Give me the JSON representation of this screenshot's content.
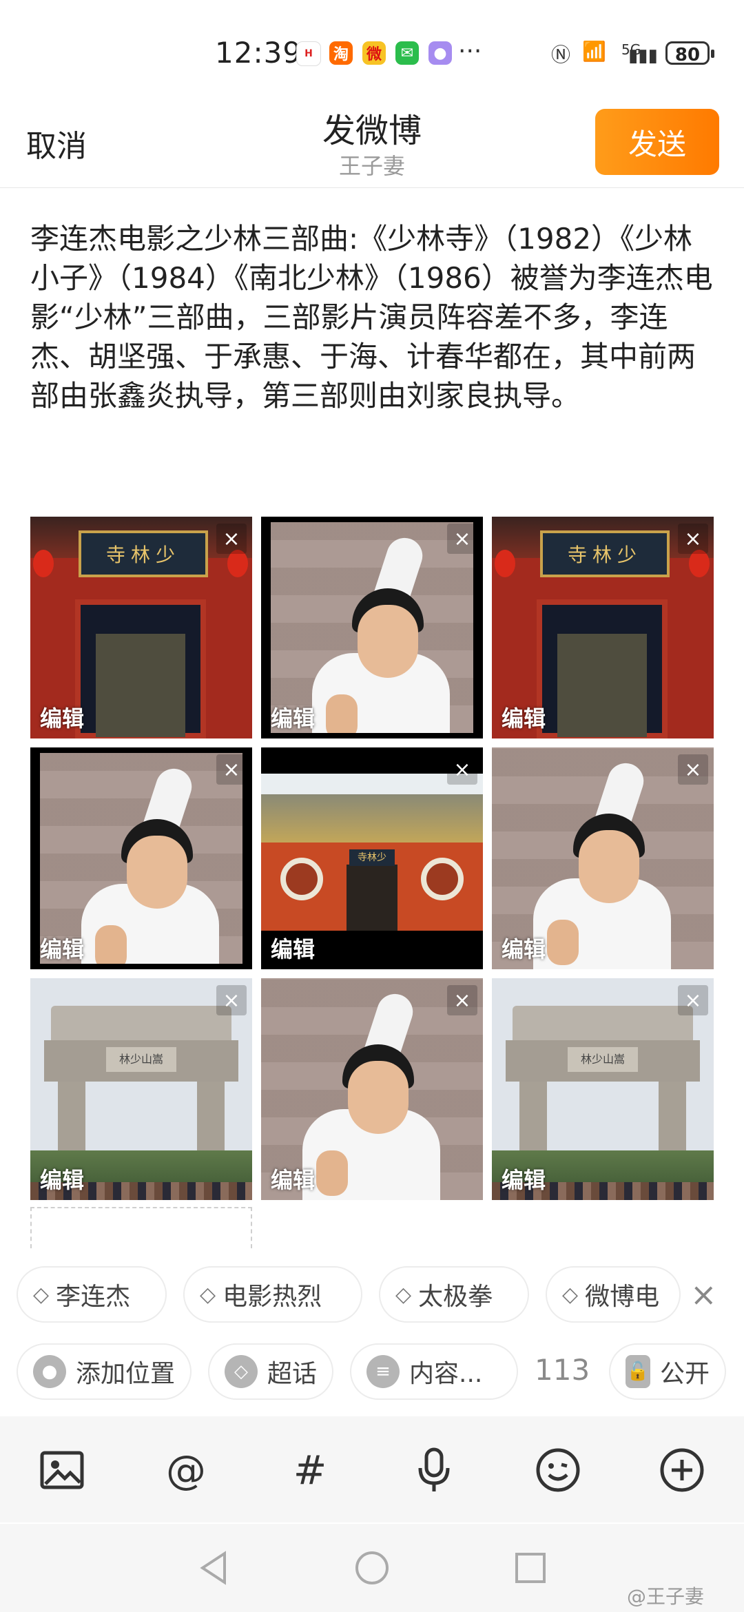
{
  "status_bar": {
    "time": "12:39",
    "apps": [
      {
        "icon": "huawei-icon",
        "color": "#ffffff"
      },
      {
        "icon": "taobao-icon",
        "color": "#ff6a00"
      },
      {
        "icon": "weibo-icon",
        "color": "#f7c325"
      },
      {
        "icon": "wechat-icon",
        "color": "#2bbd4c"
      },
      {
        "icon": "app-icon",
        "color": "#a68cf0"
      }
    ],
    "more": "···",
    "net": "5G",
    "battery": "80"
  },
  "header": {
    "cancel": "取消",
    "title": "发微博",
    "username": "王子妻",
    "send": "发送",
    "accent": "#ff8a00"
  },
  "post": {
    "text": "李连杰电影之少林三部曲:《少林寺》（1982）《少林小子》（1984）《南北少林》（1986）被誉为李连杰电影“少林”三部曲，三部影片演员阵容差不多，李连杰、胡坚强、于承惠、于海、计春华都在，其中前两部由张鑫炎执导，第三部则由刘家良执导。"
  },
  "images": [
    {
      "kind": "gate",
      "plaque": "寺林少",
      "edit": "编辑"
    },
    {
      "kind": "portrait-framed",
      "edit": "编辑"
    },
    {
      "kind": "gate",
      "plaque": "寺林少",
      "edit": "编辑"
    },
    {
      "kind": "portrait-framed",
      "edit": "编辑"
    },
    {
      "kind": "temple",
      "plaque": "寺林少",
      "edit": "编辑"
    },
    {
      "kind": "portrait",
      "edit": "编辑"
    },
    {
      "kind": "arch",
      "plaque": "林少山嵩",
      "edit": "编辑"
    },
    {
      "kind": "portrait",
      "edit": "编辑"
    },
    {
      "kind": "arch",
      "plaque": "林少山嵩",
      "edit": "编辑"
    }
  ],
  "close_glyph": "×",
  "tags": [
    "李连杰",
    "电影热烈",
    "太极拳",
    "微博电"
  ],
  "options": {
    "location": "添加位置",
    "topic": "超话",
    "content": "内容...",
    "count": "113",
    "visibility": "公开"
  },
  "toolbar": {
    "image": "image-icon",
    "mention": "@",
    "hashtag": "#",
    "voice": "microphone-icon",
    "emoji": "emoji-icon",
    "more": "plus-icon"
  },
  "watermark": "@王子妻"
}
